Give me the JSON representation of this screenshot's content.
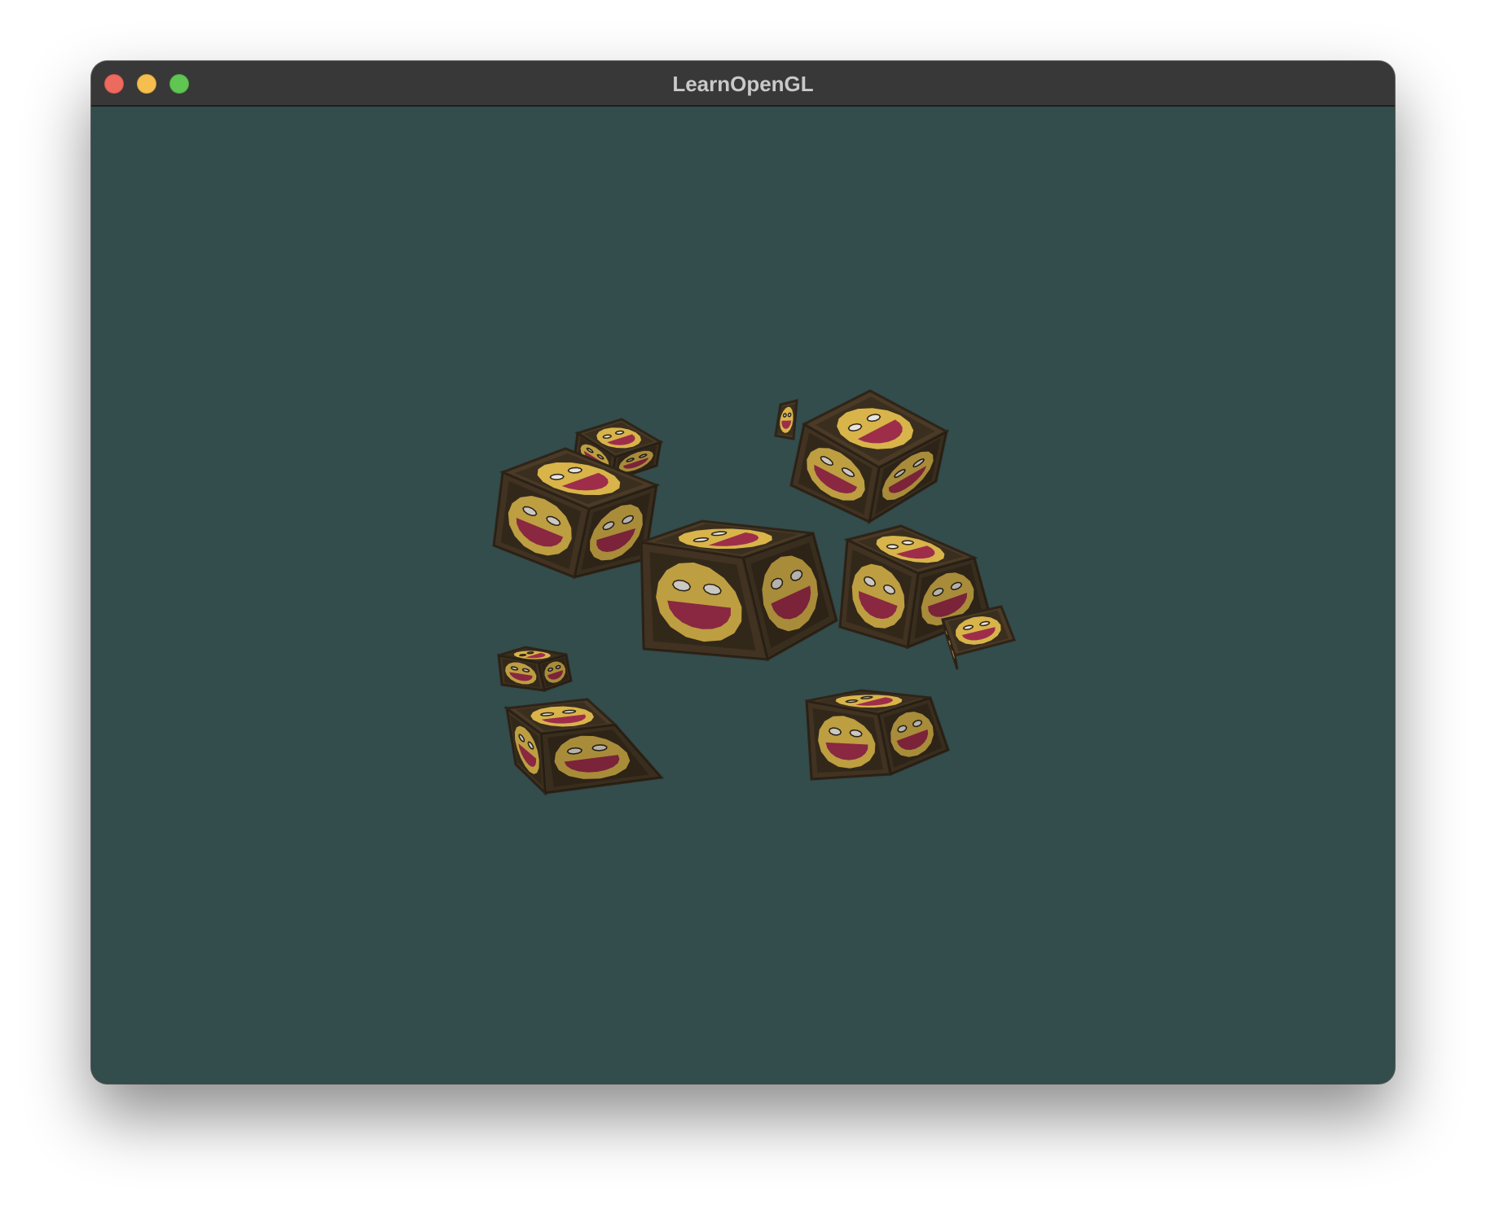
{
  "window": {
    "title": "LearnOpenGL",
    "buttons": {
      "close": "close-window",
      "minimize": "minimize-window",
      "zoom": "zoom-window"
    }
  },
  "scene": {
    "clear_color": "#334c4c",
    "cube_count": 10,
    "texture": "container-with-awesomeface",
    "colors": {
      "wood_dark": "#2e2418",
      "wood_mid": "#4a3a26",
      "face_yellow": "#d8b44a",
      "mouth_red": "#9e2d4a",
      "eye_white": "#e8e4de"
    }
  }
}
